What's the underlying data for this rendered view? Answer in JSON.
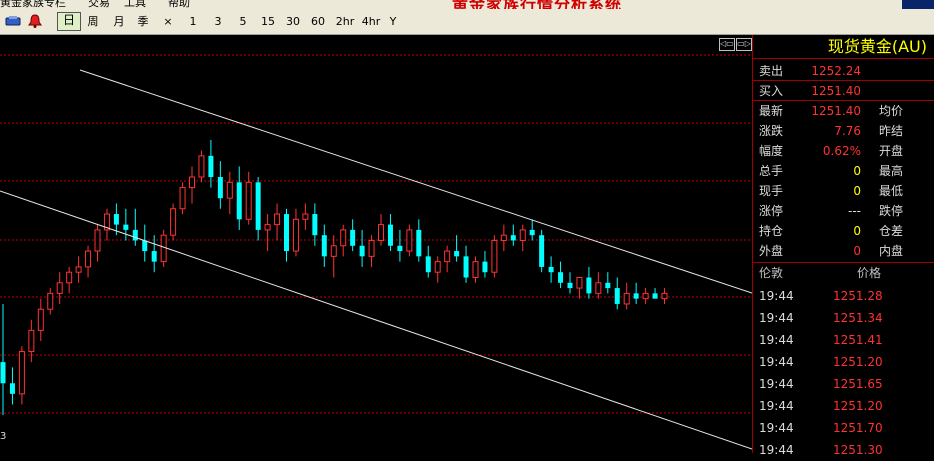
{
  "app": {
    "title": "黄金家族行情分析系统",
    "menu": [
      "黄金家族专栏",
      "交易",
      "工具",
      "帮助"
    ]
  },
  "toolbar": {
    "periods": [
      "日",
      "周",
      "月",
      "季",
      "×",
      "1",
      "3",
      "5",
      "15",
      "30",
      "60",
      "2hr",
      "4hr",
      "Y"
    ],
    "active_period": "日"
  },
  "chart": {
    "axis_partial_label": "3",
    "nav_left": "◁▭",
    "nav_right": "▭▷",
    "colors": {
      "up": "#ff3232",
      "down": "#00ffff",
      "grid": "#c00000",
      "trend": "#e6e6e6",
      "background": "#000000"
    },
    "candles": [
      [
        1236,
        1247,
        1226,
        1232
      ],
      [
        1232,
        1235,
        1228,
        1230
      ],
      [
        1230,
        1239,
        1228,
        1238
      ],
      [
        1238,
        1244,
        1236,
        1242
      ],
      [
        1242,
        1248,
        1240,
        1246
      ],
      [
        1246,
        1250,
        1245,
        1249
      ],
      [
        1249,
        1253,
        1247,
        1251
      ],
      [
        1251,
        1254,
        1249,
        1253
      ],
      [
        1253,
        1256,
        1251,
        1254
      ],
      [
        1254,
        1258,
        1252,
        1257
      ],
      [
        1257,
        1262,
        1255,
        1261
      ],
      [
        1261,
        1265,
        1259,
        1264
      ],
      [
        1264,
        1266,
        1260,
        1262
      ],
      [
        1262,
        1265,
        1259,
        1261
      ],
      [
        1261,
        1265,
        1258,
        1259
      ],
      [
        1259,
        1262,
        1255,
        1257
      ],
      [
        1257,
        1260,
        1253,
        1255
      ],
      [
        1255,
        1261,
        1254,
        1260
      ],
      [
        1260,
        1266,
        1259,
        1265
      ],
      [
        1265,
        1270,
        1264,
        1269
      ],
      [
        1269,
        1273,
        1266,
        1271
      ],
      [
        1271,
        1276,
        1270,
        1275
      ],
      [
        1275,
        1278,
        1269,
        1271
      ],
      [
        1271,
        1274,
        1265,
        1267
      ],
      [
        1267,
        1272,
        1264,
        1270
      ],
      [
        1270,
        1273,
        1261,
        1263
      ],
      [
        1263,
        1272,
        1262,
        1270
      ],
      [
        1270,
        1271,
        1259,
        1261
      ],
      [
        1261,
        1264,
        1257,
        1262
      ],
      [
        1262,
        1266,
        1259,
        1264
      ],
      [
        1264,
        1265,
        1255,
        1257
      ],
      [
        1257,
        1265,
        1256,
        1263
      ],
      [
        1263,
        1266,
        1261,
        1264
      ],
      [
        1264,
        1266,
        1258,
        1260
      ],
      [
        1260,
        1262,
        1254,
        1256
      ],
      [
        1256,
        1260,
        1252,
        1258
      ],
      [
        1258,
        1262,
        1256,
        1261
      ],
      [
        1261,
        1263,
        1257,
        1258
      ],
      [
        1258,
        1261,
        1254,
        1256
      ],
      [
        1256,
        1260,
        1254,
        1259
      ],
      [
        1259,
        1264,
        1258,
        1262
      ],
      [
        1262,
        1264,
        1257,
        1258
      ],
      [
        1258,
        1261,
        1255,
        1257
      ],
      [
        1257,
        1262,
        1256,
        1261
      ],
      [
        1261,
        1263,
        1255,
        1256
      ],
      [
        1256,
        1258,
        1252,
        1253
      ],
      [
        1253,
        1256,
        1251,
        1255
      ],
      [
        1255,
        1258,
        1253,
        1257
      ],
      [
        1257,
        1260,
        1255,
        1256
      ],
      [
        1256,
        1258,
        1251,
        1252
      ],
      [
        1252,
        1256,
        1251,
        1255
      ],
      [
        1255,
        1257,
        1252,
        1253
      ],
      [
        1253,
        1260,
        1252,
        1259
      ],
      [
        1259,
        1262,
        1257,
        1260
      ],
      [
        1260,
        1262,
        1258,
        1259
      ],
      [
        1259,
        1262,
        1257,
        1261
      ],
      [
        1261,
        1263,
        1259,
        1260
      ],
      [
        1260,
        1261,
        1253,
        1254
      ],
      [
        1254,
        1256,
        1251,
        1253
      ],
      [
        1253,
        1255,
        1250,
        1251
      ],
      [
        1251,
        1253,
        1249,
        1250
      ],
      [
        1250,
        1252,
        1248,
        1252
      ],
      [
        1252,
        1254,
        1248,
        1249
      ],
      [
        1249,
        1253,
        1248,
        1251
      ],
      [
        1251,
        1253,
        1249,
        1250
      ],
      [
        1250,
        1252,
        1246,
        1247
      ],
      [
        1247,
        1251,
        1246,
        1249
      ],
      [
        1249,
        1251,
        1247,
        1248
      ],
      [
        1248,
        1250,
        1247,
        1249
      ],
      [
        1249,
        1250,
        1248,
        1248
      ],
      [
        1248,
        1250,
        1247,
        1249
      ]
    ]
  },
  "quote": {
    "title": "现货黄金(AU)",
    "rows": [
      {
        "label": "卖出",
        "value": "1252.24",
        "label2": ""
      },
      {
        "label": "买入",
        "value": "1251.40",
        "label2": ""
      },
      {
        "label": "最新",
        "value": "1251.40",
        "label2": "均价"
      },
      {
        "label": "涨跌",
        "value": "7.76",
        "label2": "昨结"
      },
      {
        "label": "幅度",
        "value": "0.62%",
        "label2": "开盘"
      },
      {
        "label": "总手",
        "value": "0",
        "label2": "最高"
      },
      {
        "label": "现手",
        "value": "0",
        "label2": "最低"
      },
      {
        "label": "涨停",
        "value": "---",
        "label2": "跌停"
      },
      {
        "label": "持仓",
        "value": "0",
        "label2": "仓差"
      },
      {
        "label": "外盘",
        "value": "0",
        "label2": "内盘"
      }
    ],
    "ticks_header": {
      "time": "伦敦",
      "price": "价格"
    },
    "ticks": [
      {
        "time": "19:44",
        "price": "1251.28"
      },
      {
        "time": "19:44",
        "price": "1251.34"
      },
      {
        "time": "19:44",
        "price": "1251.41"
      },
      {
        "time": "19:44",
        "price": "1251.20"
      },
      {
        "time": "19:44",
        "price": "1251.65"
      },
      {
        "time": "19:44",
        "price": "1251.20"
      },
      {
        "time": "19:44",
        "price": "1251.70"
      },
      {
        "time": "19:44",
        "price": "1251.30"
      }
    ]
  }
}
